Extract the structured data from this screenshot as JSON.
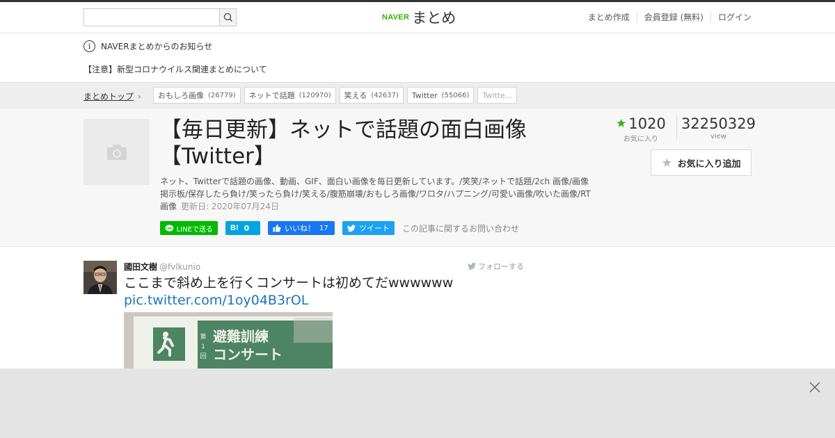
{
  "header": {
    "search": {
      "placeholder": "",
      "value": ""
    },
    "logo": {
      "naver": "NAVER",
      "matome": "まとめ"
    },
    "nav": [
      "まとめ作成",
      "会員登録 (無料)",
      "ログイン"
    ]
  },
  "notices": {
    "title": "NAVERまとめからのお知らせ",
    "item": "【注意】新型コロナウイルス関連まとめについて"
  },
  "breadcrumb": {
    "top_label": "まとめトップ",
    "tags": [
      {
        "label": "おもしろ画像",
        "count": "(26779)"
      },
      {
        "label": "ネットで話題",
        "count": "(120970)"
      },
      {
        "label": "笑える",
        "count": "(42637)"
      },
      {
        "label": "Twitter",
        "count": "(55066)"
      },
      {
        "label": "Twitte...",
        "count": ""
      }
    ]
  },
  "article": {
    "title_line1": "【毎日更新】ネットで話題の面白画像",
    "title_line2": "【Twitter】",
    "description": "ネット、Twitterで話題の画像、動画、GIF、面白い画像を毎日更新しています。/笑笑/ネットで話題/2ch 画像/画像掲示板/保存したら負け/笑ったら負け/笑える/腹筋崩壊/おもしろ画像/ワロタ/ハプニング/可愛い画像/吹いた画像/RT画像",
    "updated": "更新日: 2020年07月24日",
    "favorites": "1020",
    "favorites_label": "お気に入り",
    "views": "32250329",
    "views_label": "view",
    "fav_button": "お気に入り追加"
  },
  "share": {
    "line": "LINEで送る",
    "hatena_count": "0",
    "fb_label": "いいね！",
    "fb_count": "17",
    "tweet": "ツイート",
    "inquiry": "この記事に関するお問い合わせ"
  },
  "tweet": {
    "name": "國田文樹",
    "handle": "@fvlkunio",
    "follow": "フォローする",
    "text": "ここまで斜め上を行くコンサートは初めてだwwwwww",
    "link": "pic.twitter.com/1oy04B3rOL",
    "image_text_small": "第\n1\n回",
    "image_text_line1": "避難訓練",
    "image_text_line2": "コンサート"
  },
  "colors": {
    "brand": "#2db400",
    "line": "#00b900",
    "hatena": "#00a4de",
    "facebook": "#1877f2",
    "twitter": "#1da1f2",
    "link": "#1b75bb"
  }
}
